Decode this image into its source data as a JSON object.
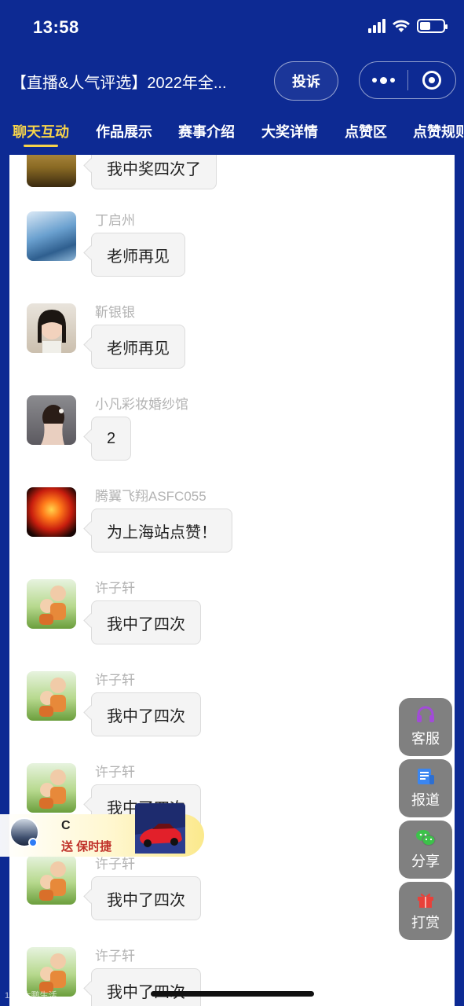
{
  "status_bar": {
    "time": "13:58"
  },
  "header": {
    "title": "【直播&人气评选】2022年全...",
    "complain_label": "投诉"
  },
  "tabs": [
    {
      "label": "聊天互动",
      "active": true
    },
    {
      "label": "作品展示",
      "active": false
    },
    {
      "label": "赛事介绍",
      "active": false
    },
    {
      "label": "大奖详情",
      "active": false
    },
    {
      "label": "点赞区",
      "active": false
    },
    {
      "label": "点赞规则",
      "active": false
    }
  ],
  "messages": [
    {
      "name": "",
      "text": "我中奖四次了",
      "avatar": "gold-avatar"
    },
    {
      "name": "丁启州",
      "text": "老师再见",
      "avatar": "water-avatar"
    },
    {
      "name": "靳银银",
      "text": "老师再见",
      "avatar": "girl-avatar"
    },
    {
      "name": "小凡彩妆婚纱馆",
      "text": "2",
      "avatar": "back-avatar"
    },
    {
      "name": "腾翼飞翔ASFC055",
      "text": "为上海站点赞！",
      "avatar": "phoenix-avatar"
    },
    {
      "name": "许子轩",
      "text": "我中了四次",
      "avatar": "kids-avatar"
    },
    {
      "name": "许子轩",
      "text": "我中了四次",
      "avatar": "kids-avatar"
    },
    {
      "name": "许子轩",
      "text": "我中了四次",
      "avatar": "kids-avatar"
    },
    {
      "name": "许子轩",
      "text": "我中了四次",
      "avatar": "kids-avatar"
    },
    {
      "name": "许子轩",
      "text": "我中了四次",
      "avatar": "kids-avatar"
    }
  ],
  "side_buttons": [
    {
      "label": "客服",
      "icon": "headset-icon",
      "color": "#a24bd8"
    },
    {
      "label": "报道",
      "icon": "news-icon",
      "color": "#3b86f0"
    },
    {
      "label": "分享",
      "icon": "wechat-icon",
      "color": "#3cc24a"
    },
    {
      "label": "打赏",
      "icon": "gift-icon",
      "color": "#e8413a"
    }
  ],
  "gift_toast": {
    "user": "C",
    "text": "送 保时捷",
    "gift_icon": "sports-car-icon"
  },
  "watermark": "10²² 大鹏生活"
}
